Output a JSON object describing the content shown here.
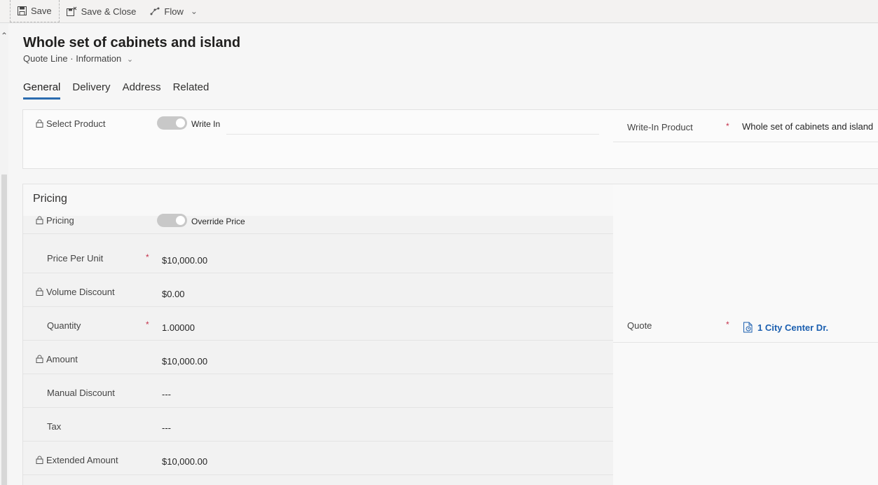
{
  "toolbar": {
    "save_label": "Save",
    "save_close_label": "Save & Close",
    "flow_label": "Flow"
  },
  "header": {
    "title": "Whole set of cabinets and island",
    "entity": "Quote Line",
    "separator": "·",
    "form": "Information"
  },
  "tabs": [
    {
      "label": "General",
      "active": true
    },
    {
      "label": "Delivery"
    },
    {
      "label": "Address"
    },
    {
      "label": "Related"
    }
  ],
  "product": {
    "select_label": "Select Product",
    "toggle_value": "Write In",
    "writein_label": "Write-In Product",
    "writein_value": "Whole set of cabinets and island"
  },
  "pricing": {
    "section_title": "Pricing",
    "pricing_label": "Pricing",
    "pricing_toggle": "Override Price",
    "fields": [
      {
        "label": "Price Per Unit",
        "value": "$10,000.00"
      },
      {
        "label": "Volume Discount",
        "value": "$0.00"
      },
      {
        "label": "Quantity",
        "value": "1.00000"
      },
      {
        "label": "Amount",
        "value": "$10,000.00"
      },
      {
        "label": "Manual Discount",
        "value": "---"
      },
      {
        "label": "Tax",
        "value": "---"
      },
      {
        "label": "Extended Amount",
        "value": "$10,000.00"
      }
    ],
    "quote_label": "Quote",
    "quote_value": "1 City Center Dr."
  },
  "required_marker": "*",
  "colors": {
    "accent": "#2b6cb0",
    "link": "#1b5fb0",
    "required": "#c4314b"
  }
}
